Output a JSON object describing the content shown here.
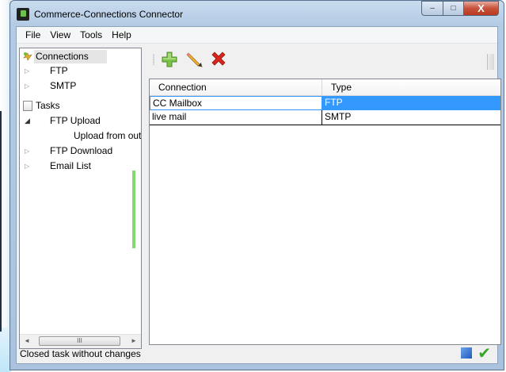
{
  "window": {
    "title": "Commerce-Connections Connector",
    "minimize_glyph": "–",
    "maximize_glyph": "□",
    "close_glyph": "X"
  },
  "menu": [
    "File",
    "View",
    "Tools",
    "Help"
  ],
  "tree": {
    "connections_label": "Connections",
    "connection_children": [
      "FTP",
      "SMTP"
    ],
    "tasks_label": "Tasks",
    "ftp_upload_label": "FTP Upload",
    "ftp_upload_child": "Upload from out",
    "ftp_download_label": "FTP Download",
    "email_list_label": "Email List",
    "scroll_left": "◄",
    "scroll_right": "►",
    "scroll_thumb_grip": "III"
  },
  "toolbar": {
    "icons": [
      "add-icon",
      "edit-pencil-icon",
      "delete-x-icon"
    ]
  },
  "grid": {
    "columns": [
      "Connection",
      "Type"
    ],
    "rows": [
      {
        "connection": "CC Mailbox",
        "type": "FTP",
        "selected": true
      },
      {
        "connection": "live mail",
        "type": "SMTP",
        "selected": false
      }
    ],
    "selection_color": "#3399ff"
  },
  "status": {
    "text": "Closed task without changes",
    "check_glyph": "✔"
  }
}
